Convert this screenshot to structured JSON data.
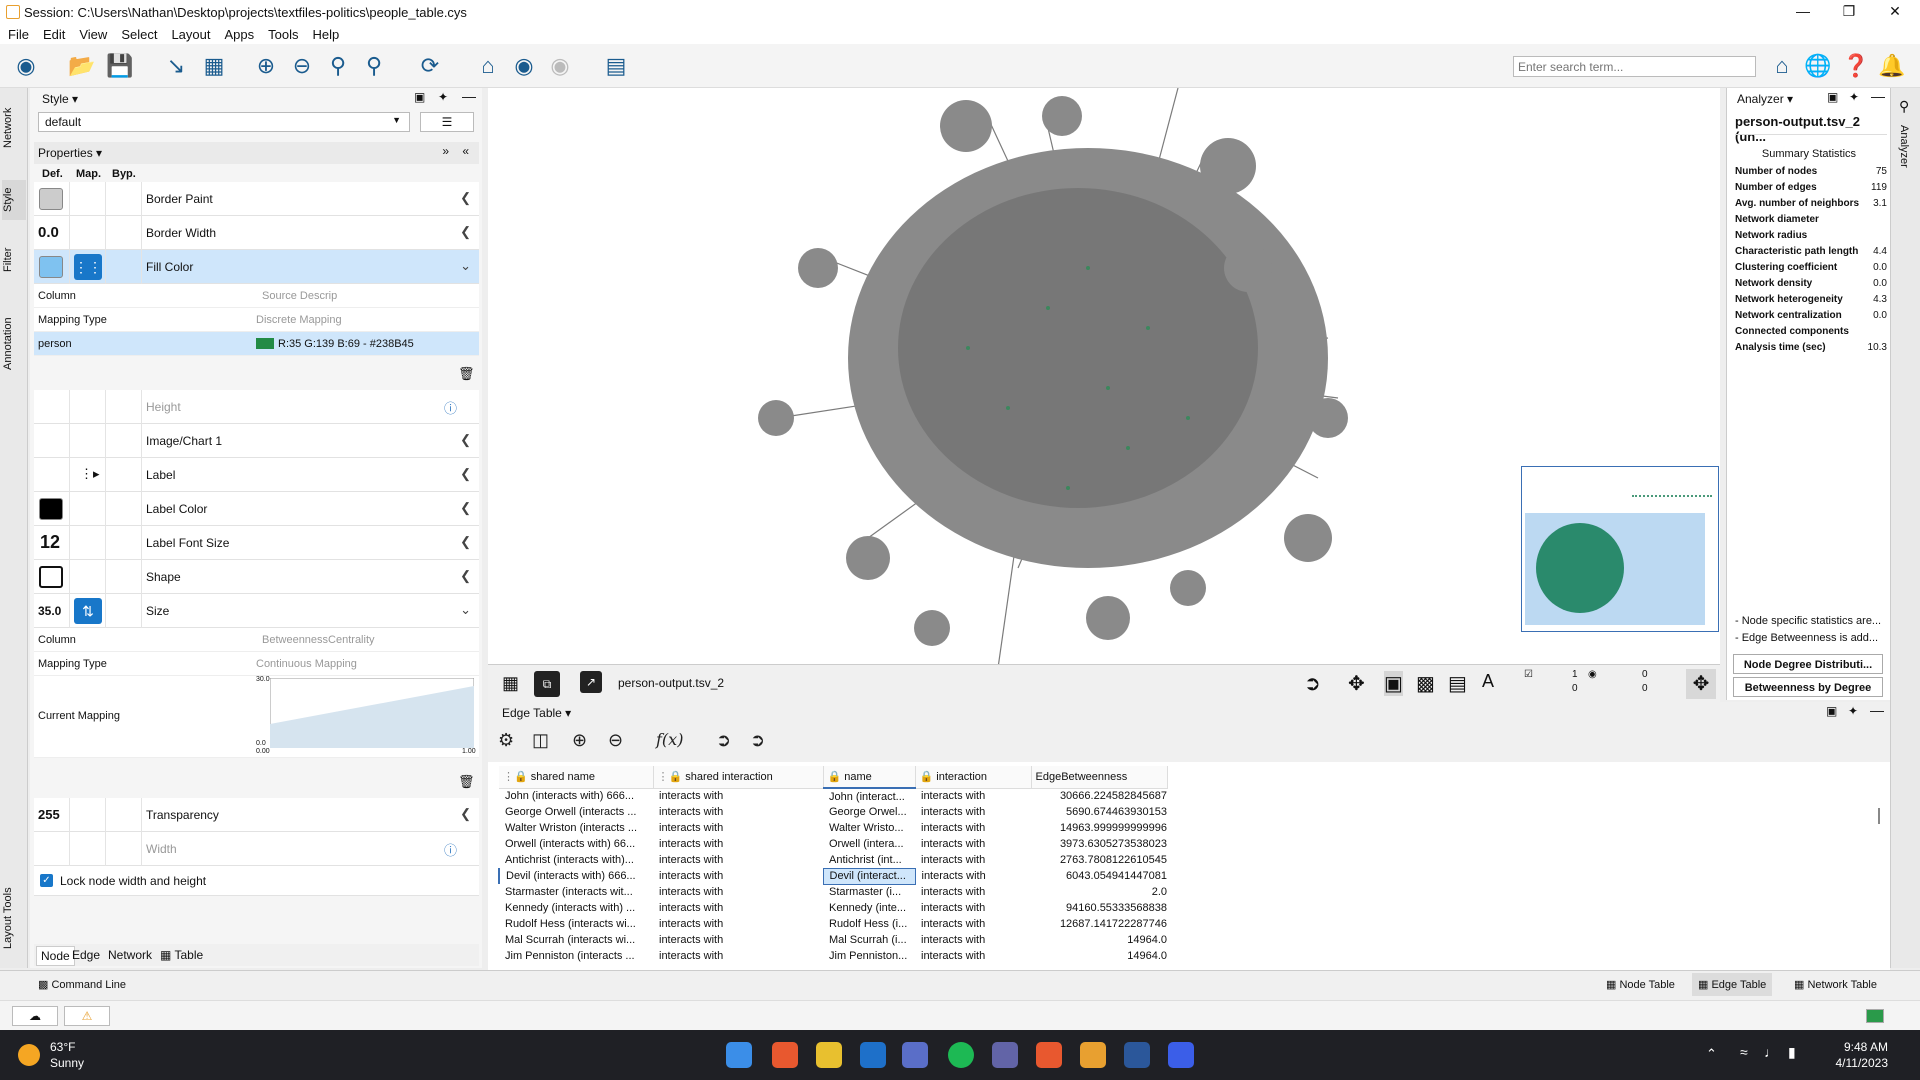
{
  "window": {
    "title": "Session: C:\\Users\\Nathan\\Desktop\\projects\\textfiles-politics\\people_table.cys"
  },
  "menu": [
    "File",
    "Edit",
    "View",
    "Select",
    "Layout",
    "Apps",
    "Tools",
    "Help"
  ],
  "search": {
    "placeholder": "Enter search term..."
  },
  "left_tabs": [
    "Network",
    "Style",
    "Filter",
    "Annotation",
    "Layout Tools"
  ],
  "style": {
    "header": "Style",
    "preset": "default",
    "properties_label": "Properties",
    "col_def": "Def.",
    "col_map": "Map.",
    "col_byp": "Byp.",
    "rows": [
      {
        "label": "Border Paint"
      },
      {
        "label": "Border Width",
        "value": "0.0"
      },
      {
        "label": "Fill Color"
      },
      {
        "label": "Height"
      },
      {
        "label": "Image/Chart 1"
      },
      {
        "label": "Label"
      },
      {
        "label": "Label Color"
      },
      {
        "label": "Label Font Size",
        "value": "12"
      },
      {
        "label": "Shape"
      },
      {
        "label": "Size",
        "value": "35.0"
      },
      {
        "label": "Transparency",
        "value": "255"
      },
      {
        "label": "Width"
      }
    ],
    "fill_mapping": {
      "column_key": "Column",
      "column_val": "Source Descrip",
      "type_key": "Mapping Type",
      "type_val": "Discrete Mapping",
      "entry_key": "person",
      "entry_val": "R:35 G:139 B:69 - #238B45",
      "entry_color": "#238B45"
    },
    "size_mapping": {
      "column_key": "Column",
      "column_val": "BetweennessCentrality",
      "type_key": "Mapping Type",
      "type_val": "Continuous Mapping",
      "current_key": "Current Mapping",
      "y_max": "30.0",
      "y_min": "0.0",
      "x_min": "0.00",
      "x_max": "1.00"
    },
    "lock_label": "Lock node width and height",
    "bottom_tabs": [
      "Node",
      "Edge",
      "Network",
      "Table"
    ]
  },
  "network": {
    "name": "person-output.tsv_2",
    "sel_nodes": "1",
    "sel_edges": "0",
    "hid_nodes": "0",
    "hid_edges": "0"
  },
  "analyzer": {
    "header": "Analyzer",
    "title": "person-output.tsv_2 (un...",
    "summary": "Summary Statistics",
    "stats": [
      {
        "k": "Number of nodes",
        "v": "75"
      },
      {
        "k": "Number of edges",
        "v": "119"
      },
      {
        "k": "Avg. number of neighbors",
        "v": "3.1"
      },
      {
        "k": "Network diameter",
        "v": ""
      },
      {
        "k": "Network radius",
        "v": ""
      },
      {
        "k": "Characteristic path length",
        "v": "4.4"
      },
      {
        "k": "Clustering coefficient",
        "v": "0.0"
      },
      {
        "k": "Network density",
        "v": "0.0"
      },
      {
        "k": "Network heterogeneity",
        "v": "4.3"
      },
      {
        "k": "Network centralization",
        "v": "0.0"
      },
      {
        "k": "Connected components",
        "v": ""
      },
      {
        "k": "Analysis time (sec)",
        "v": "10.3"
      }
    ],
    "note1": "- Node specific statistics are...",
    "note2": "- Edge Betweenness is add...",
    "btn1": "Node Degree Distributi...",
    "btn2": "Betweenness by Degree",
    "side_tab": "Analyzer"
  },
  "edge_table": {
    "header": "Edge Table",
    "columns": [
      "shared name",
      "shared interaction",
      "name",
      "interaction",
      "EdgeBetweenness"
    ],
    "rows": [
      [
        "John (interacts with) 666...",
        "interacts with",
        "John (interact...",
        "interacts with",
        "30666.224582845687"
      ],
      [
        "George Orwell (interacts ...",
        "interacts with",
        "George Orwel...",
        "interacts with",
        "5690.674463930153"
      ],
      [
        "Walter Wriston (interacts ...",
        "interacts with",
        "Walter Wristo...",
        "interacts with",
        "14963.999999999996"
      ],
      [
        "Orwell (interacts with) 66...",
        "interacts with",
        "Orwell (intera...",
        "interacts with",
        "3973.6305273538023"
      ],
      [
        "Antichrist (interacts with)...",
        "interacts with",
        "Antichrist (int...",
        "interacts with",
        "2763.7808122610545"
      ],
      [
        "Devil (interacts with) 666...",
        "interacts with",
        "Devil (interact...",
        "interacts with",
        "6043.054941447081"
      ],
      [
        "Starmaster (interacts wit...",
        "interacts with",
        "Starmaster (i...",
        "interacts with",
        "2.0"
      ],
      [
        "Kennedy (interacts with) ...",
        "interacts with",
        "Kennedy (inte...",
        "interacts with",
        "94160.55333568838"
      ],
      [
        "Rudolf Hess (interacts wi...",
        "interacts with",
        "Rudolf Hess (i...",
        "interacts with",
        "12687.141722287746"
      ],
      [
        "Mal Scurrah (interacts wi...",
        "interacts with",
        "Mal Scurrah (i...",
        "interacts with",
        "14964.0"
      ],
      [
        "Jim Penniston (interacts ...",
        "interacts with",
        "Jim Penniston...",
        "interacts with",
        "14964.0"
      ]
    ]
  },
  "bottom": {
    "command_line": "Command Line",
    "node_table": "Node Table",
    "edge_table": "Edge Table",
    "network_table": "Network Table"
  },
  "taskbar": {
    "temp": "63°F",
    "weather": "Sunny",
    "time": "9:48 AM",
    "date": "4/11/2023"
  }
}
